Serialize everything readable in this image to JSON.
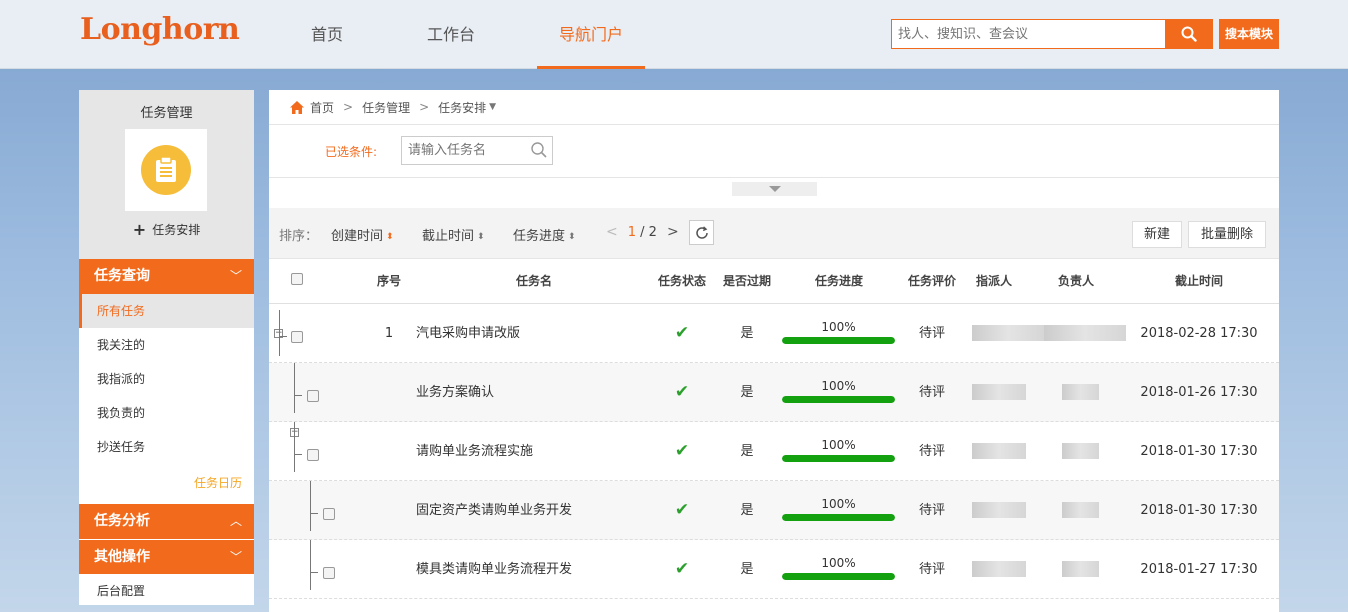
{
  "header": {
    "logo": "Longhorn",
    "nav": [
      "首页",
      "工作台",
      "导航门户"
    ],
    "nav_active_index": 2,
    "search_placeholder": "找人、搜知识、查会议",
    "module_search_label": "搜本模块",
    "accent_color": "#f26b1d"
  },
  "sidebar": {
    "title": "任务管理",
    "add_label": "任务安排",
    "sections": [
      {
        "label": "任务查询",
        "expanded": true
      },
      {
        "label": "任务分析",
        "expanded": false
      },
      {
        "label": "其他操作",
        "expanded": true
      }
    ],
    "query_items": [
      "所有任务",
      "我关注的",
      "我指派的",
      "我负责的",
      "抄送任务"
    ],
    "active_item_index": 0,
    "calendar_link": "任务日历",
    "other_items": [
      "后台配置"
    ]
  },
  "breadcrumb": [
    "首页",
    "任务管理",
    "任务安排"
  ],
  "filter": {
    "label": "已选条件:",
    "placeholder": "请输入任务名"
  },
  "sortbar": {
    "label": "排序：",
    "sorts": [
      "创建时间",
      "截止时间",
      "任务进度"
    ],
    "active_sort_index": 0,
    "page_current": "1",
    "page_sep": " / ",
    "page_total": "2",
    "new_button": "新建",
    "batch_delete_button": "批量删除"
  },
  "table": {
    "columns": [
      "序号",
      "任务名",
      "任务状态",
      "是否过期",
      "任务进度",
      "任务评价",
      "指派人",
      "负责人",
      "截止时间"
    ],
    "rows": [
      {
        "index": "1",
        "name": "汽电采购申请改版",
        "status": "✔",
        "expired": "是",
        "progress_text": "100%",
        "progress": 1.0,
        "rating": "待评",
        "deadline": "2018-02-28 17:30",
        "level": 0,
        "expander": true
      },
      {
        "index": "",
        "name": "业务方案确认",
        "status": "✔",
        "expired": "是",
        "progress_text": "100%",
        "progress": 1.0,
        "rating": "待评",
        "deadline": "2018-01-26 17:30",
        "level": 1,
        "expander": false
      },
      {
        "index": "",
        "name": "请购单业务流程实施",
        "status": "✔",
        "expired": "是",
        "progress_text": "100%",
        "progress": 1.0,
        "rating": "待评",
        "deadline": "2018-01-30 17:30",
        "level": 1,
        "expander": true
      },
      {
        "index": "",
        "name": "固定资产类请购单业务开发",
        "status": "✔",
        "expired": "是",
        "progress_text": "100%",
        "progress": 1.0,
        "rating": "待评",
        "deadline": "2018-01-30 17:30",
        "level": 2,
        "expander": false
      },
      {
        "index": "",
        "name": "模具类请购单业务流程开发",
        "status": "✔",
        "expired": "是",
        "progress_text": "100%",
        "progress": 1.0,
        "rating": "待评",
        "deadline": "2018-01-27 17:30",
        "level": 2,
        "expander": false
      }
    ]
  }
}
